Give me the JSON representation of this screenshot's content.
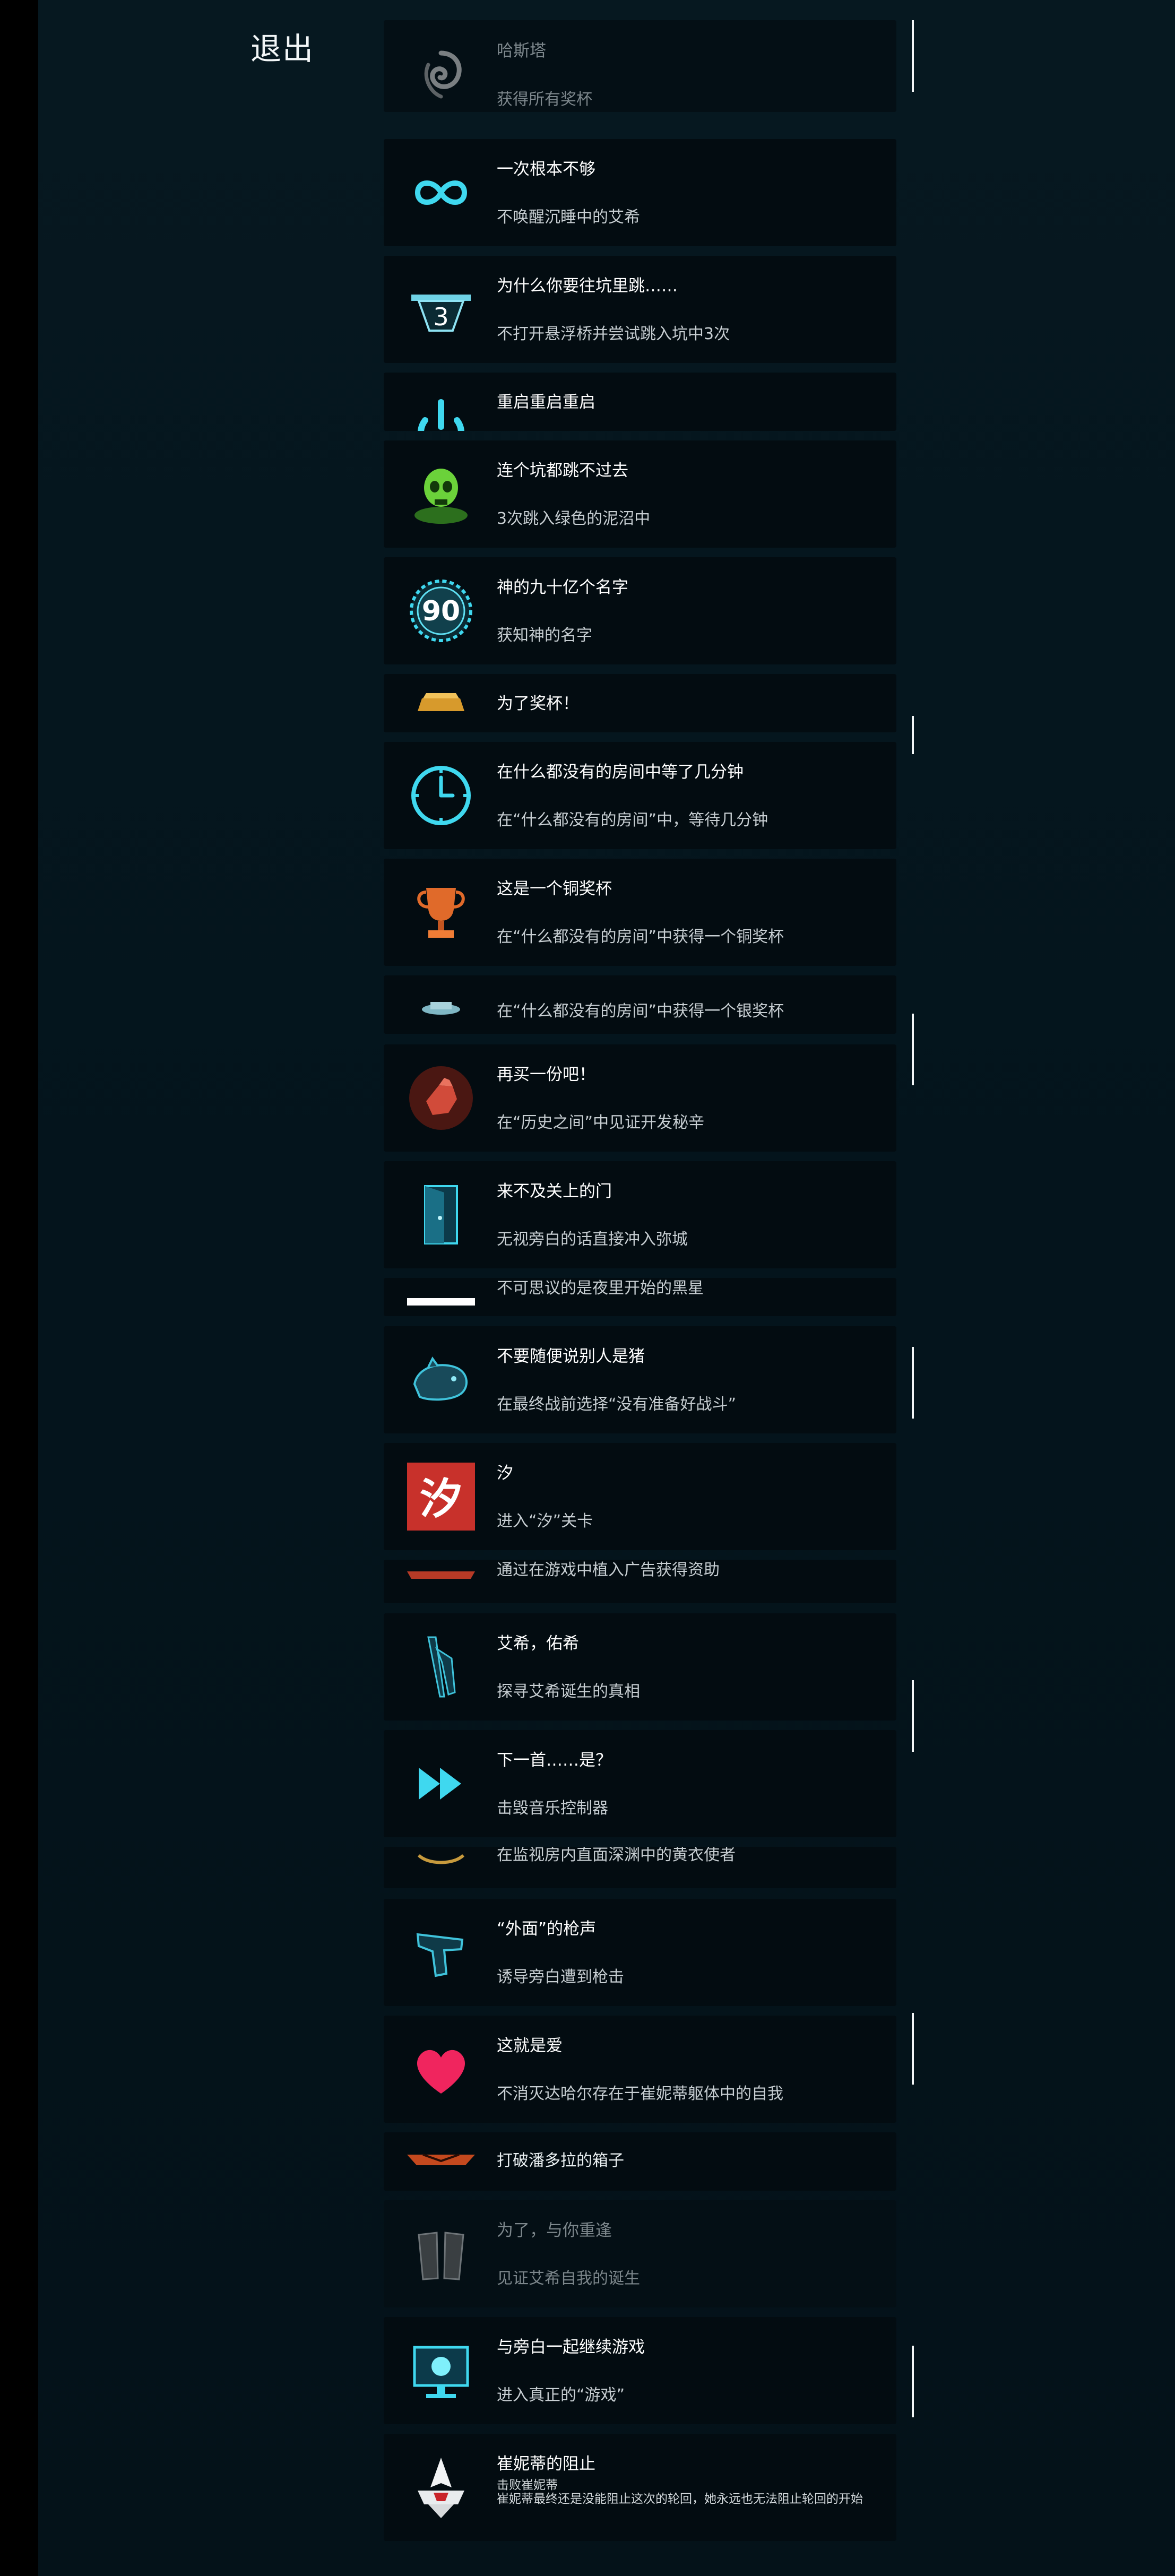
{
  "header": {
    "exit_label": "退出"
  },
  "achievements": [
    {
      "id": "a1",
      "title": "哈斯塔",
      "desc": "获得所有奖杯",
      "icon": "hastur-sigil-icon",
      "locked": true
    },
    {
      "id": "a2",
      "title": "一次根本不够",
      "desc": "不唤醒沉睡中的艾希",
      "icon": "infinity-icon",
      "locked": false
    },
    {
      "id": "a3",
      "title": "为什么你要往坑里跳……",
      "desc": "不打开悬浮桥并尝试跳入坑中3次",
      "icon": "pit-three-icon",
      "icon_text": "3",
      "locked": false
    },
    {
      "id": "a4",
      "title": "重启重启重启",
      "desc": "",
      "icon": "power-icon",
      "locked": false
    },
    {
      "id": "a5",
      "title": "连个坑都跳不过去",
      "desc": "3次跳入绿色的泥沼中",
      "icon": "green-skull-icon",
      "locked": false
    },
    {
      "id": "a6",
      "title": "神的九十亿个名字",
      "desc": "获知神的名字",
      "icon": "ninety-badge-icon",
      "icon_text": "90",
      "locked": false
    },
    {
      "id": "a7",
      "title": "为了奖杯！",
      "desc": "",
      "icon": "gold-trophy-icon",
      "locked": false
    },
    {
      "id": "a8",
      "title": "在什么都没有的房间中等了几分钟",
      "desc": "在“什么都没有的房间”中，等待几分钟",
      "icon": "clock-icon",
      "locked": false
    },
    {
      "id": "a9",
      "title": "这是一个铜奖杯",
      "desc": "在“什么都没有的房间”中获得一个铜奖杯",
      "icon": "bronze-trophy-icon",
      "locked": false
    },
    {
      "id": "a10",
      "title": "",
      "desc": "在“什么都没有的房间”中获得一个银奖杯",
      "icon": "silver-trophy-icon",
      "locked": false
    },
    {
      "id": "a11",
      "title": "再买一份吧！",
      "desc": "在“历史之间”中见证开发秘辛",
      "icon": "fist-icon",
      "locked": false
    },
    {
      "id": "a12",
      "title": "来不及关上的门",
      "desc": "无视旁白的话直接冲入弥城",
      "icon": "door-icon",
      "locked": false
    },
    {
      "id": "a13",
      "title": "",
      "desc": "不可思议的是夜里开始的黑星",
      "icon": "white-bar-icon",
      "locked": false
    },
    {
      "id": "a14",
      "title": "不要随便说别人是猪",
      "desc": "在最终战前选择“没有准备好战斗”",
      "icon": "pig-icon",
      "locked": false
    },
    {
      "id": "a15",
      "title": "汐",
      "desc": "进入“汐”关卡",
      "icon": "xi-seal-icon",
      "icon_text": "汐",
      "locked": false
    },
    {
      "id": "a16",
      "title": "",
      "desc": "通过在游戏中植入广告获得资助",
      "icon": "red-banner-icon",
      "locked": false
    },
    {
      "id": "a17",
      "title": "艾希，佑希",
      "desc": "探寻艾希诞生的真相",
      "icon": "blade-icon",
      "locked": false
    },
    {
      "id": "a18",
      "title": "下一首……是？",
      "desc": "击毁音乐控制器",
      "icon": "fast-forward-icon",
      "locked": false
    },
    {
      "id": "a19",
      "title": "",
      "desc": "在监视房内直面深渊中的黄衣使者",
      "icon": "gold-ring-icon",
      "locked": false
    },
    {
      "id": "a20",
      "title": "“外面”的枪声",
      "desc": "诱导旁白遭到枪击",
      "icon": "pistol-icon",
      "locked": false
    },
    {
      "id": "a21",
      "title": "这就是爱",
      "desc": "不消灭达哈尔存在于崔妮蒂躯体中的自我",
      "icon": "heart-icon",
      "locked": false
    },
    {
      "id": "a22",
      "title": "",
      "desc": "打破潘多拉的箱子",
      "icon": "pandora-box-icon",
      "locked": false
    },
    {
      "id": "a23",
      "title": "为了，与你重逢",
      "desc": "见证艾希自我的诞生",
      "icon": "gauntlets-icon",
      "locked": true
    },
    {
      "id": "a24",
      "title": "与旁白一起继续游戏",
      "desc": "进入真正的“游戏”",
      "icon": "monitor-icon",
      "locked": false
    },
    {
      "id": "a25",
      "title": "崔妮蒂的阻止",
      "desc": "击败崔妮蒂",
      "desc2": "崔妮蒂最终还是没能阻止这次的轮回，她永远也无法阻止轮回的开始",
      "icon": "trinity-emblem-icon",
      "locked": false
    }
  ]
}
